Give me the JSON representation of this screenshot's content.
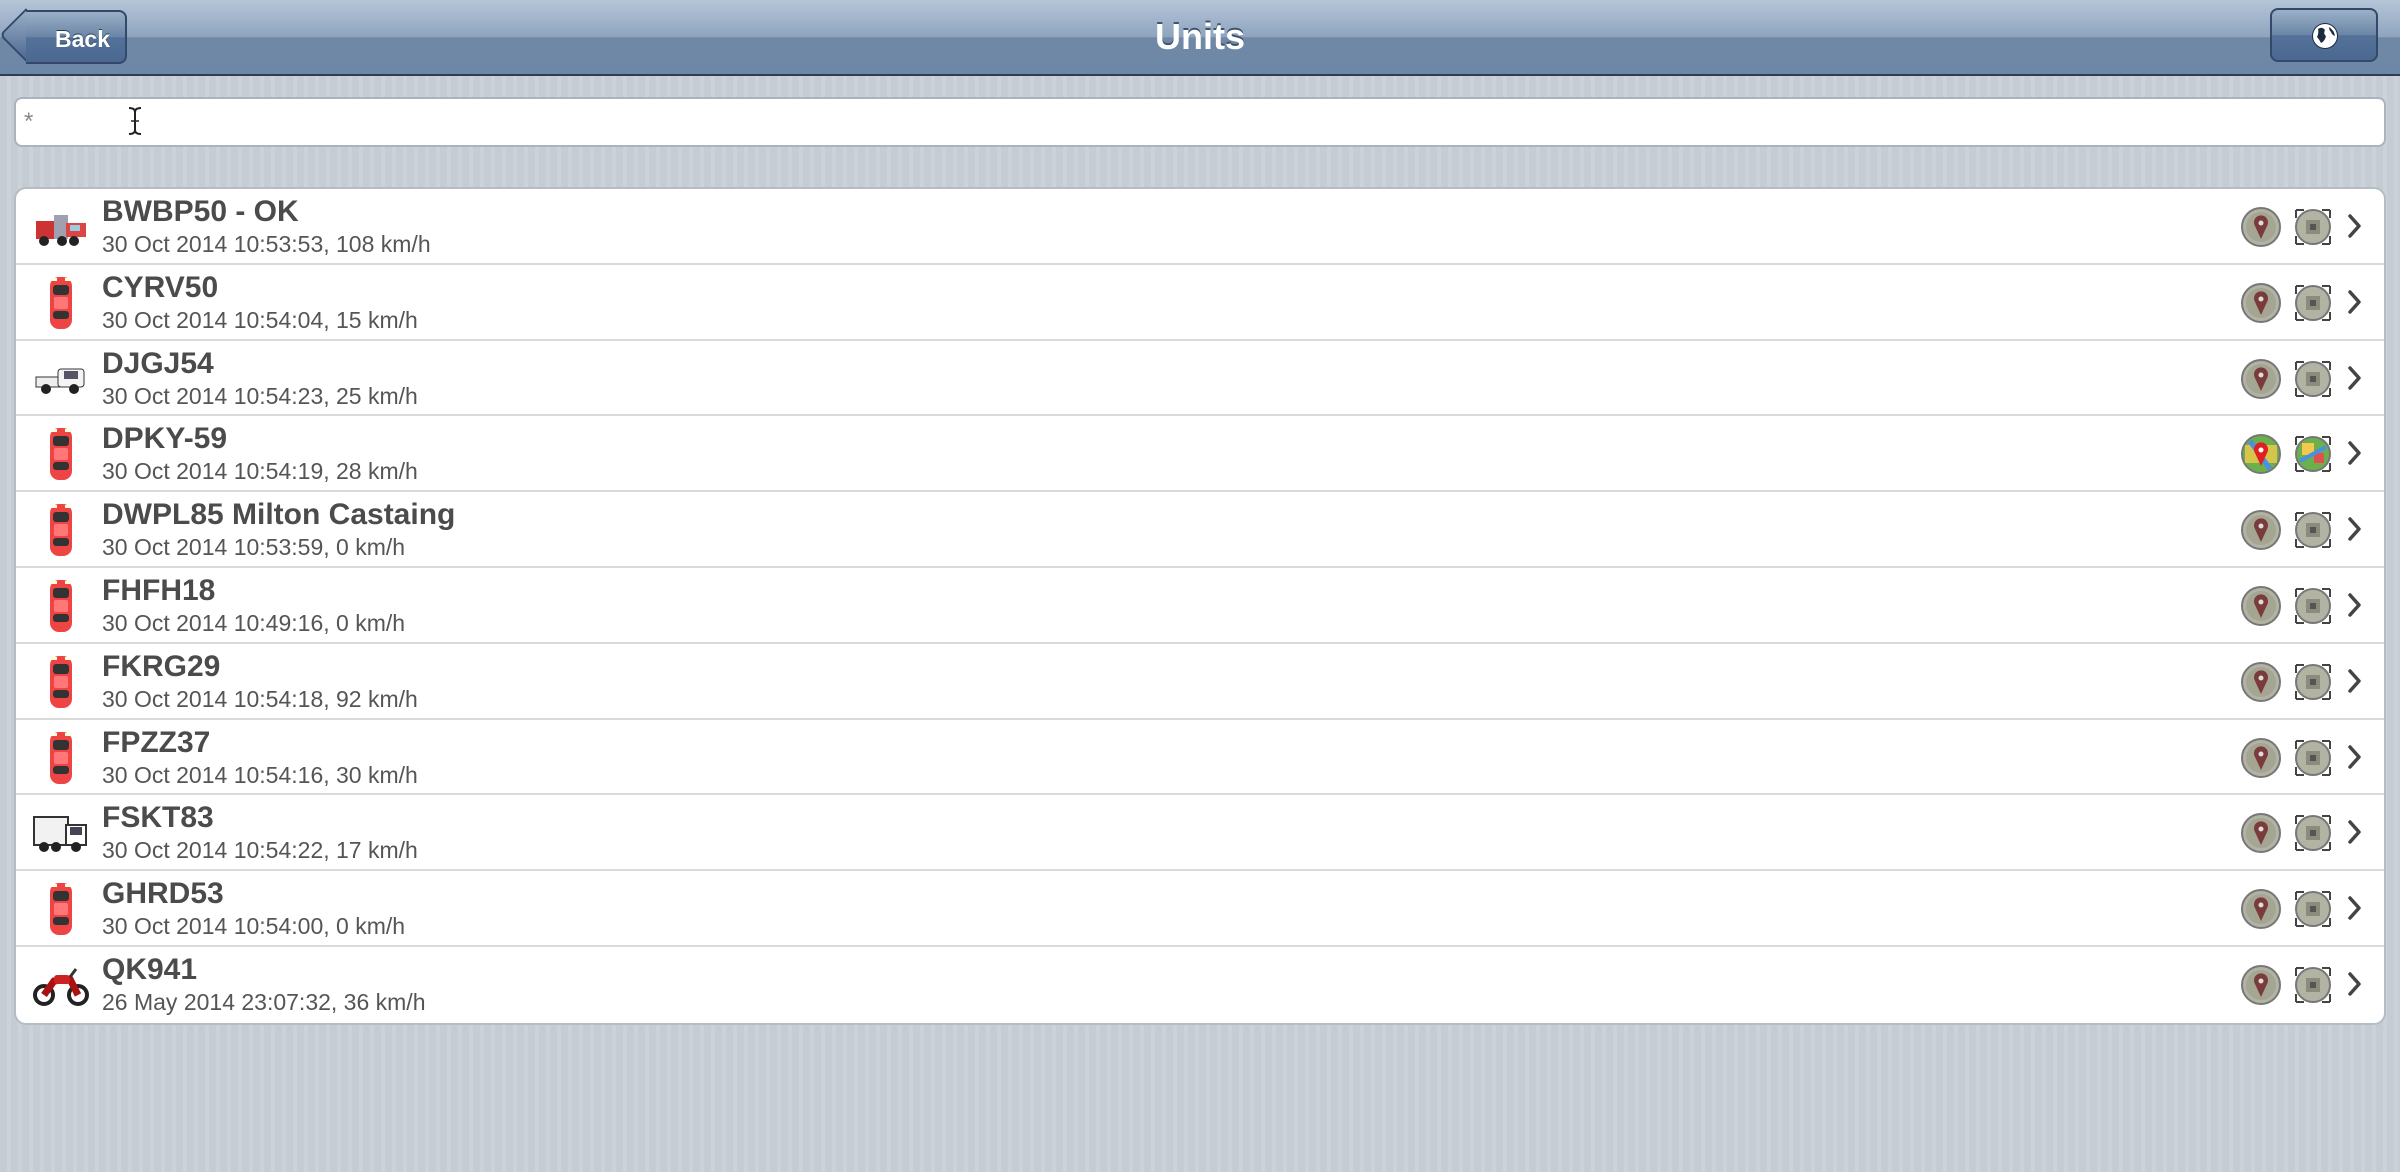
{
  "header": {
    "title": "Units",
    "back_label": "Back"
  },
  "search": {
    "value": "*",
    "placeholder": ""
  },
  "units": [
    {
      "name": "BWBP50 - OK",
      "details": "30 Oct 2014 10:53:53, 108 km/h",
      "icon": "truck-icon",
      "active": false
    },
    {
      "name": "CYRV50",
      "details": "30 Oct 2014 10:54:04, 15 km/h",
      "icon": "car-icon",
      "active": false
    },
    {
      "name": "DJGJ54",
      "details": "30 Oct 2014 10:54:23, 25 km/h",
      "icon": "pickup-truck-icon",
      "active": false
    },
    {
      "name": "DPKY-59",
      "details": "30 Oct 2014 10:54:19, 28 km/h",
      "icon": "car-icon",
      "active": true
    },
    {
      "name": "DWPL85 Milton Castaing",
      "details": "30 Oct 2014 10:53:59, 0 km/h",
      "icon": "car-icon",
      "active": false
    },
    {
      "name": "FHFH18",
      "details": "30 Oct 2014 10:49:16, 0 km/h",
      "icon": "car-icon",
      "active": false
    },
    {
      "name": "FKRG29",
      "details": "30 Oct 2014 10:54:18, 92 km/h",
      "icon": "car-icon",
      "active": false
    },
    {
      "name": "FPZZ37",
      "details": "30 Oct 2014 10:54:16, 30 km/h",
      "icon": "car-icon",
      "active": false
    },
    {
      "name": "FSKT83",
      "details": "30 Oct 2014 10:54:22, 17 km/h",
      "icon": "cargo-truck-icon",
      "active": false
    },
    {
      "name": "GHRD53",
      "details": "30 Oct 2014 10:54:00, 0 km/h",
      "icon": "car-icon",
      "active": false
    },
    {
      "name": "QK941",
      "details": "26 May 2014 23:07:32, 36 km/h",
      "icon": "motorcycle-icon",
      "active": false
    }
  ],
  "colors": {
    "nav_dark": "#4b6891",
    "active_pin": "#e02020",
    "inactive_icon": "#9a9a8a"
  }
}
